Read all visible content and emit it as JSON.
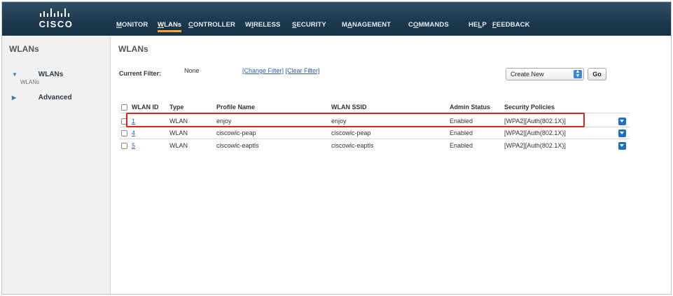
{
  "brand": {
    "name": "CISCO"
  },
  "nav": {
    "items": [
      {
        "pre": "",
        "u": "M",
        "post": "ONITOR"
      },
      {
        "pre": "",
        "u": "W",
        "post": "LANs"
      },
      {
        "pre": "",
        "u": "C",
        "post": "ONTROLLER"
      },
      {
        "pre": "W",
        "u": "I",
        "post": "RELESS"
      },
      {
        "pre": "",
        "u": "S",
        "post": "ECURITY"
      },
      {
        "pre": "M",
        "u": "A",
        "post": "NAGEMENT"
      },
      {
        "pre": "C",
        "u": "O",
        "post": "MMANDS"
      },
      {
        "pre": "HE",
        "u": "L",
        "post": "P"
      },
      {
        "pre": "",
        "u": "F",
        "post": "EEDBACK"
      }
    ]
  },
  "sidebar": {
    "title": "WLANs",
    "items": [
      {
        "label": "WLANs",
        "sub": "WLANs",
        "arrow": "▼"
      },
      {
        "label": "Advanced",
        "arrow": "▶"
      }
    ]
  },
  "main": {
    "title": "WLANs",
    "filter": {
      "label": "Current Filter:",
      "value": "None",
      "change": "[Change Filter]",
      "clear": "[Clear Filter]"
    },
    "create": {
      "selected": "Create New",
      "go": "Go"
    },
    "table": {
      "headers": [
        "WLAN ID",
        "Type",
        "Profile Name",
        "WLAN SSID",
        "Admin Status",
        "Security Policies"
      ],
      "rows": [
        {
          "id": "1",
          "type": "WLAN",
          "profile": "enjoy",
          "ssid": "enjoy",
          "status": "Enabled",
          "security": "[WPA2][Auth(802.1X)]"
        },
        {
          "id": "4",
          "type": "WLAN",
          "profile": "ciscowlc-peap",
          "ssid": "ciscowlc-peap",
          "status": "Enabled",
          "security": "[WPA2][Auth(802.1X)]"
        },
        {
          "id": "5",
          "type": "WLAN",
          "profile": "ciscowlc-eaptls",
          "ssid": "ciscowlc-eaptls",
          "status": "Enabled",
          "security": "[WPA2][Auth(802.1X)]"
        }
      ]
    }
  },
  "colors": {
    "header": "#1f3a4f",
    "accent": "#f5a623",
    "link": "#2a5db0",
    "highlight": "#d8261f",
    "menu_button": "#1f6fc6"
  }
}
